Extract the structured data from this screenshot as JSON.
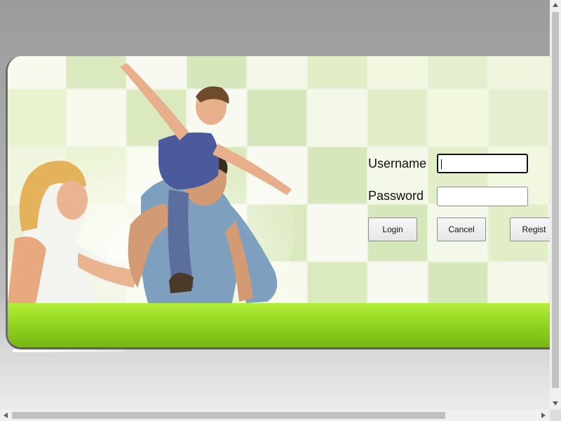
{
  "login": {
    "username_label": "Username",
    "password_label": "Password",
    "username_value": "",
    "password_value": "",
    "login_button": "Login",
    "cancel_button": "Cancel",
    "register_button": "Regist"
  },
  "theme": {
    "accent_green": "#93d41e",
    "tile_green": "#cfe3a6",
    "background_gray": "#a3a3a3"
  },
  "icons": {
    "photo": "family-photo",
    "scroll_up": "arrow-up-icon",
    "scroll_down": "arrow-down-icon",
    "scroll_left": "arrow-left-icon",
    "scroll_right": "arrow-right-icon"
  }
}
